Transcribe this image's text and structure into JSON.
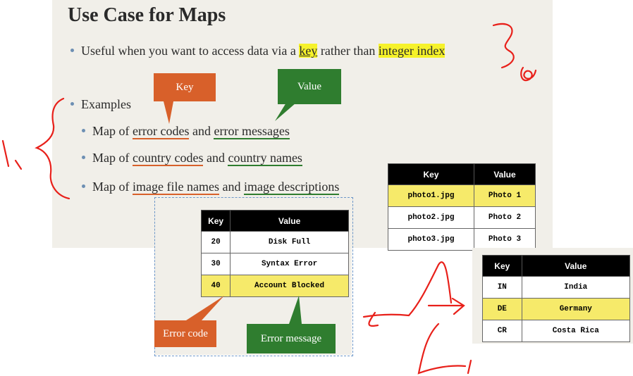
{
  "slide": {
    "title": "Use Case for Maps",
    "bullet1": {
      "text_a": "Useful when you want to access data via a ",
      "key_word": "key",
      "text_b": " rather than ",
      "integer_index": "integer index"
    },
    "examples_label": "Examples",
    "example1": {
      "a": "Map of ",
      "b": "error codes",
      "c": " and ",
      "d": "error messages"
    },
    "example2": {
      "a": "Map of ",
      "b": "country codes",
      "c": " and ",
      "d": "country names"
    },
    "example3": {
      "a": "Map of ",
      "b": "image file names",
      "c": " and ",
      "d": "image descriptions"
    },
    "callout_key": "Key",
    "callout_value": "Value"
  },
  "error_table": {
    "headers": [
      "Key",
      "Value"
    ],
    "rows": [
      [
        "20",
        "Disk Full"
      ],
      [
        "30",
        "Syntax Error"
      ],
      [
        "40",
        "Account Blocked"
      ]
    ],
    "callout_code": "Error code",
    "callout_message": "Error message"
  },
  "image_table": {
    "headers": [
      "Key",
      "Value"
    ],
    "rows": [
      [
        "photo1.jpg",
        "Photo 1"
      ],
      [
        "photo2.jpg",
        "Photo 2"
      ],
      [
        "photo3.jpg",
        "Photo 3"
      ]
    ]
  },
  "country_table": {
    "headers": [
      "Key",
      "Value"
    ],
    "rows": [
      [
        "IN",
        "India"
      ],
      [
        "DE",
        "Germany"
      ],
      [
        "CR",
        "Costa Rica"
      ]
    ]
  },
  "colors": {
    "orange": "#d8602a",
    "green": "#2f7d2f",
    "highlight": "#f6ea6a",
    "ink": "#e8201a"
  }
}
